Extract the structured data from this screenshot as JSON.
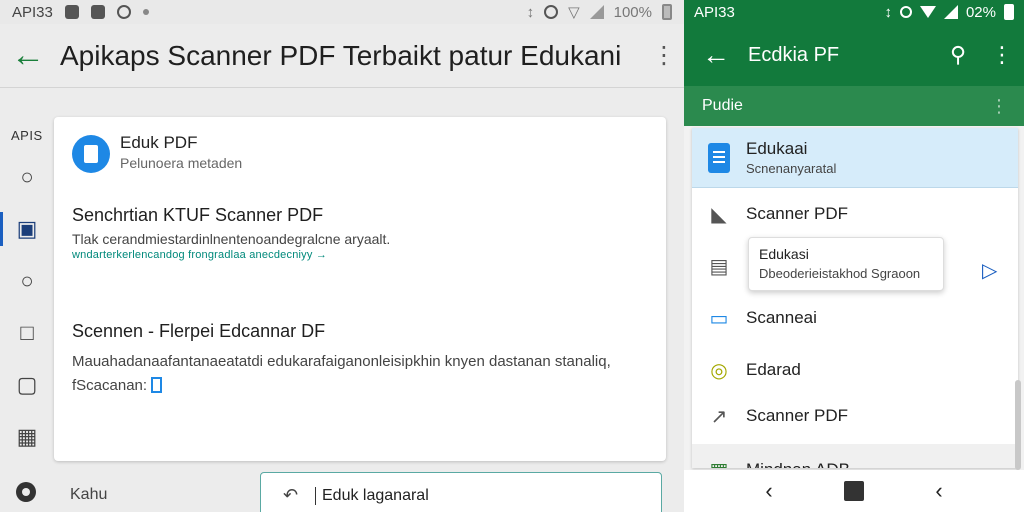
{
  "left_status": {
    "api": "API33",
    "battery": "100%"
  },
  "left_appbar": {
    "title": "Apikaps Scanner PDF Terbaikt patur Edukani"
  },
  "rail": {
    "label": "APIS"
  },
  "card": {
    "app_name": "Eduk PDF",
    "app_subtitle": "Pelunoera metaden",
    "section1_title": "Senchrtian KTUF Scanner PDF",
    "section1_text": "Tlak cerandmiestardinlnentenoandegralcne aryaalt.",
    "section1_link": "wndarterkerlencandog frongradlaa anecdecniyy  →",
    "section2_title": "Scennen - Flerpei  Edcannar DF",
    "section2_text": "Mauahadanaafantanaeatatdi edukarafaiganonleisipkhin knyen dastanan stanaliq,",
    "section2_text2": "fScacanan:"
  },
  "left_bottom": {
    "label": "Kahu",
    "input_value": "Eduk laganaral"
  },
  "right_status": {
    "api": "API33",
    "battery": "02%"
  },
  "right_appbar": {
    "title": "Ecdkia PF"
  },
  "right_sub": {
    "title": "Pudie"
  },
  "right_list": {
    "selected": {
      "title": "Edukaai",
      "subtitle": "Scnenanyaratal"
    },
    "items": [
      {
        "label": "Scanner PDF"
      },
      {
        "label": "Scanneai"
      },
      {
        "label": "Edarad"
      },
      {
        "label": "Scanner PDF"
      },
      {
        "label": "Mindnan ADB"
      }
    ],
    "popup": {
      "title": "Edukasi",
      "subtitle": "Dbeoderieistakhod Sgraoon"
    }
  },
  "colors": {
    "green": "#127a3c",
    "accent_blue": "#1e88e5",
    "selected_bg": "#d6ecfa"
  }
}
